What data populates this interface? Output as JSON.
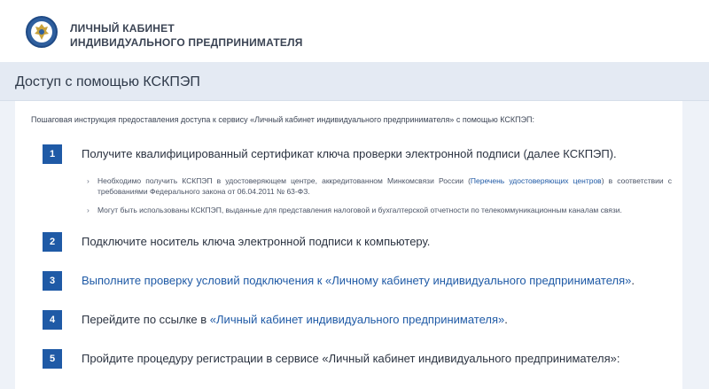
{
  "header": {
    "brand_line1": "ЛИЧНЫЙ КАБИНЕТ",
    "brand_line2": "ИНДИВИДУАЛЬНОГО ПРЕДПРИНИМАТЕЛЯ",
    "logo_icon": "fns-emblem-icon"
  },
  "section": {
    "title": "Доступ с помощью КСКПЭП"
  },
  "intro": "Пошаговая инструкция предоставления доступа к сервису «Личный кабинет индивидуального предпринимателя» с помощью КСКПЭП:",
  "steps": [
    {
      "number": "1",
      "text": "Получите квалифицированный сертификат ключа проверки электронной подписи (далее КСКПЭП).",
      "bullets": [
        {
          "pre": "Необходимо получить КСКПЭП в удостоверяющем центре, аккредитованном Минкомсвязи России (",
          "link": "Перечень удостоверяющих центров",
          "post": ") в соответствии с требованиями Федерального закона от 06.04.2011 № 63-ФЗ."
        },
        {
          "pre": "Могут быть использованы КСКПЭП, выданные для представления налоговой и бухгалтерской отчетности по телекоммуникационным каналам связи.",
          "link": "",
          "post": ""
        }
      ]
    },
    {
      "number": "2",
      "text": "Подключите носитель ключа электронной подписи к компьютеру."
    },
    {
      "number": "3",
      "link": "Выполните проверку условий подключения к «Личному кабинету индивидуального предпринимателя»",
      "post": "."
    },
    {
      "number": "4",
      "pre": "Перейдите по ссылке в ",
      "link": "«Личный кабинет индивидуального предпринимателя»",
      "post": "."
    },
    {
      "number": "5",
      "text": "Пройдите процедуру регистрации в сервисе «Личный кабинет индивидуального предпринимателя»:"
    }
  ],
  "colors": {
    "accent": "#1f5aa6",
    "panel_bg": "#eef2f8"
  }
}
